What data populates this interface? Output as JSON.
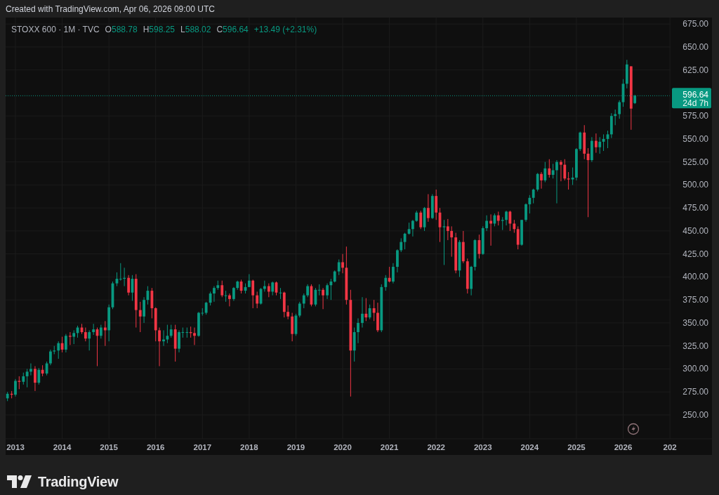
{
  "header": {
    "text": "Created with TradingView.com, Apr 06, 2026 09:00 UTC"
  },
  "chart": {
    "legend": {
      "symbol": "STOXX 600 · 1M · TVC",
      "ohlc": [
        {
          "key": "O",
          "value": "588.78"
        },
        {
          "key": "H",
          "value": "598.25"
        },
        {
          "key": "L",
          "value": "588.02"
        },
        {
          "key": "C",
          "value": "596.64"
        }
      ],
      "change": "+13.49 (+2.31%)"
    },
    "price_tag": {
      "price": "596.64",
      "countdown": "24d 7h"
    },
    "cut_axis_label": "202",
    "chart_data": {
      "type": "candlestick",
      "grid": true,
      "xlim": [
        2012.79,
        2027.9
      ],
      "ylim": [
        224,
        682
      ],
      "xticks": [
        2013,
        2014,
        2015,
        2016,
        2017,
        2018,
        2019,
        2020,
        2021,
        2022,
        2023,
        2024,
        2025,
        2026
      ],
      "yticks": [
        {
          "value": 250,
          "label": "250.00"
        },
        {
          "value": 275,
          "label": "275.00"
        },
        {
          "value": 300,
          "label": "300.00"
        },
        {
          "value": 325,
          "label": "325.00"
        },
        {
          "value": 350,
          "label": "350.00"
        },
        {
          "value": 375,
          "label": "375.00"
        },
        {
          "value": 400,
          "label": "400.00"
        },
        {
          "value": 425,
          "label": "425.00"
        },
        {
          "value": 450,
          "label": "450.00"
        },
        {
          "value": 475,
          "label": "475.00"
        },
        {
          "value": 500,
          "label": "500.00"
        },
        {
          "value": 525,
          "label": "525.00"
        },
        {
          "value": 550,
          "label": "550.00"
        },
        {
          "value": 575,
          "label": "575.00"
        },
        {
          "value": 625,
          "label": "625.00"
        },
        {
          "value": 650,
          "label": "650.00"
        },
        {
          "value": 675,
          "label": "675.00"
        }
      ],
      "ref_lines": [
        {
          "axis": "y",
          "value": 597,
          "color": "#089981"
        }
      ],
      "x": [
        2012.83,
        2012.92,
        2013,
        2013.08,
        2013.17,
        2013.25,
        2013.33,
        2013.42,
        2013.5,
        2013.58,
        2013.67,
        2013.75,
        2013.83,
        2013.92,
        2014,
        2014.08,
        2014.17,
        2014.25,
        2014.33,
        2014.42,
        2014.5,
        2014.58,
        2014.67,
        2014.75,
        2014.83,
        2014.92,
        2015,
        2015.08,
        2015.17,
        2015.25,
        2015.33,
        2015.42,
        2015.5,
        2015.58,
        2015.67,
        2015.75,
        2015.83,
        2015.92,
        2016,
        2016.08,
        2016.17,
        2016.25,
        2016.33,
        2016.42,
        2016.5,
        2016.58,
        2016.67,
        2016.75,
        2016.83,
        2016.92,
        2017,
        2017.08,
        2017.17,
        2017.25,
        2017.33,
        2017.42,
        2017.5,
        2017.58,
        2017.67,
        2017.75,
        2017.83,
        2017.92,
        2018,
        2018.08,
        2018.17,
        2018.25,
        2018.33,
        2018.42,
        2018.5,
        2018.58,
        2018.67,
        2018.75,
        2018.83,
        2018.92,
        2019,
        2019.08,
        2019.17,
        2019.25,
        2019.33,
        2019.42,
        2019.5,
        2019.58,
        2019.67,
        2019.75,
        2019.83,
        2019.92,
        2020,
        2020.08,
        2020.17,
        2020.25,
        2020.33,
        2020.42,
        2020.5,
        2020.58,
        2020.67,
        2020.75,
        2020.83,
        2020.92,
        2021,
        2021.08,
        2021.17,
        2021.25,
        2021.33,
        2021.42,
        2021.5,
        2021.58,
        2021.67,
        2021.75,
        2021.83,
        2021.92,
        2022,
        2022.08,
        2022.17,
        2022.25,
        2022.33,
        2022.42,
        2022.5,
        2022.58,
        2022.67,
        2022.75,
        2022.83,
        2022.92,
        2023,
        2023.08,
        2023.17,
        2023.25,
        2023.33,
        2023.42,
        2023.5,
        2023.58,
        2023.67,
        2023.75,
        2023.83,
        2023.92,
        2024,
        2024.08,
        2024.17,
        2024.25,
        2024.33,
        2024.42,
        2024.5,
        2024.58,
        2024.67,
        2024.75,
        2024.83,
        2024.92,
        2025,
        2025.08,
        2025.17,
        2025.25,
        2025.33,
        2025.42,
        2025.5,
        2025.58,
        2025.67,
        2025.75,
        2025.83,
        2025.92,
        2026,
        2026.08,
        2026.17,
        2026.25
      ],
      "ohlc": [
        [
          268,
          275,
          265,
          273
        ],
        [
          273,
          276,
          268,
          272
        ],
        [
          272,
          289,
          270,
          287
        ],
        [
          287,
          292,
          278,
          286
        ],
        [
          286,
          296,
          283,
          292
        ],
        [
          292,
          300,
          280,
          297
        ],
        [
          297,
          306,
          293,
          300
        ],
        [
          300,
          303,
          276,
          285
        ],
        [
          285,
          301,
          283,
          299
        ],
        [
          299,
          304,
          292,
          295
        ],
        [
          295,
          308,
          293,
          306
        ],
        [
          306,
          321,
          304,
          319
        ],
        [
          319,
          325,
          316,
          320
        ],
        [
          320,
          330,
          311,
          328
        ],
        [
          328,
          335,
          318,
          321
        ],
        [
          321,
          338,
          318,
          336
        ],
        [
          336,
          340,
          326,
          335
        ],
        [
          335,
          342,
          327,
          339
        ],
        [
          339,
          347,
          334,
          345
        ],
        [
          345,
          349,
          338,
          340
        ],
        [
          340,
          345,
          330,
          333
        ],
        [
          333,
          342,
          320,
          340
        ],
        [
          340,
          349,
          337,
          343
        ],
        [
          343,
          345,
          303,
          336
        ],
        [
          336,
          348,
          333,
          345
        ],
        [
          345,
          352,
          325,
          342
        ],
        [
          342,
          370,
          330,
          367
        ],
        [
          367,
          395,
          365,
          393
        ],
        [
          393,
          405,
          390,
          398
        ],
        [
          398,
          415,
          396,
          398
        ],
        [
          398,
          410,
          390,
          399
        ],
        [
          399,
          402,
          380,
          383
        ],
        [
          383,
          402,
          374,
          398
        ],
        [
          398,
          403,
          345,
          364
        ],
        [
          364,
          373,
          340,
          357
        ],
        [
          357,
          378,
          350,
          375
        ],
        [
          375,
          390,
          370,
          385
        ],
        [
          385,
          388,
          355,
          366
        ],
        [
          366,
          367,
          330,
          342
        ],
        [
          342,
          345,
          303,
          330
        ],
        [
          330,
          342,
          325,
          332
        ],
        [
          332,
          348,
          328,
          336
        ],
        [
          336,
          348,
          334,
          343
        ],
        [
          343,
          348,
          308,
          322
        ],
        [
          322,
          342,
          318,
          340
        ],
        [
          340,
          345,
          334,
          340
        ],
        [
          340,
          345,
          334,
          340
        ],
        [
          340,
          346,
          334,
          339
        ],
        [
          339,
          345,
          326,
          336
        ],
        [
          336,
          362,
          335,
          361
        ],
        [
          361,
          366,
          358,
          361
        ],
        [
          361,
          373,
          359,
          372
        ],
        [
          372,
          384,
          369,
          382
        ],
        [
          382,
          390,
          373,
          388
        ],
        [
          388,
          396,
          386,
          391
        ],
        [
          391,
          396,
          378,
          380
        ],
        [
          380,
          385,
          373,
          380
        ],
        [
          380,
          382,
          368,
          376
        ],
        [
          376,
          389,
          374,
          388
        ],
        [
          388,
          396,
          386,
          395
        ],
        [
          395,
          397,
          382,
          385
        ],
        [
          385,
          393,
          382,
          389
        ],
        [
          389,
          403,
          389,
          396
        ],
        [
          396,
          397,
          366,
          380
        ],
        [
          380,
          384,
          366,
          371
        ],
        [
          371,
          388,
          370,
          387
        ],
        [
          387,
          396,
          384,
          390
        ],
        [
          390,
          393,
          378,
          384
        ],
        [
          384,
          395,
          380,
          394
        ],
        [
          394,
          395,
          380,
          383
        ],
        [
          383,
          388,
          376,
          383
        ],
        [
          383,
          384,
          356,
          362
        ],
        [
          362,
          369,
          354,
          357
        ],
        [
          357,
          361,
          330,
          338
        ],
        [
          338,
          360,
          336,
          358
        ],
        [
          358,
          373,
          356,
          371
        ],
        [
          371,
          382,
          366,
          380
        ],
        [
          380,
          392,
          378,
          390
        ],
        [
          390,
          392,
          368,
          370
        ],
        [
          370,
          388,
          368,
          386
        ],
        [
          386,
          392,
          380,
          386
        ],
        [
          386,
          388,
          365,
          380
        ],
        [
          380,
          393,
          376,
          391
        ],
        [
          391,
          398,
          375,
          395
        ],
        [
          395,
          407,
          394,
          406
        ],
        [
          406,
          419,
          402,
          416
        ],
        [
          416,
          425,
          404,
          410
        ],
        [
          410,
          433,
          370,
          375
        ],
        [
          375,
          386,
          270,
          320
        ],
        [
          320,
          345,
          308,
          340
        ],
        [
          340,
          355,
          328,
          350
        ],
        [
          350,
          378,
          345,
          360
        ],
        [
          360,
          377,
          352,
          356
        ],
        [
          356,
          370,
          354,
          366
        ],
        [
          366,
          375,
          352,
          361
        ],
        [
          361,
          372,
          340,
          342
        ],
        [
          342,
          392,
          340,
          389
        ],
        [
          389,
          402,
          385,
          399
        ],
        [
          399,
          411,
          394,
          395
        ],
        [
          395,
          415,
          393,
          411
        ],
        [
          411,
          430,
          405,
          429
        ],
        [
          429,
          442,
          427,
          438
        ],
        [
          438,
          448,
          430,
          447
        ],
        [
          447,
          459,
          446,
          452
        ],
        [
          452,
          462,
          444,
          461
        ],
        [
          461,
          472,
          460,
          470
        ],
        [
          470,
          472,
          452,
          454
        ],
        [
          454,
          476,
          450,
          475
        ],
        [
          475,
          490,
          460,
          464
        ],
        [
          464,
          490,
          463,
          488
        ],
        [
          488,
          495,
          462,
          470
        ],
        [
          470,
          475,
          438,
          454
        ],
        [
          454,
          462,
          413,
          455
        ],
        [
          455,
          463,
          440,
          450
        ],
        [
          450,
          455,
          422,
          443
        ],
        [
          443,
          448,
          404,
          407
        ],
        [
          407,
          440,
          400,
          438
        ],
        [
          438,
          450,
          415,
          417
        ],
        [
          417,
          420,
          382,
          387
        ],
        [
          387,
          412,
          380,
          411
        ],
        [
          411,
          441,
          407,
          440
        ],
        [
          440,
          446,
          420,
          425
        ],
        [
          425,
          455,
          424,
          453
        ],
        [
          453,
          467,
          450,
          461
        ],
        [
          461,
          468,
          434,
          458
        ],
        [
          458,
          469,
          455,
          467
        ],
        [
          467,
          471,
          456,
          461
        ],
        [
          461,
          465,
          451,
          462
        ],
        [
          462,
          472,
          456,
          471
        ],
        [
          471,
          472,
          450,
          458
        ],
        [
          458,
          462,
          448,
          452
        ],
        [
          452,
          455,
          430,
          435
        ],
        [
          435,
          462,
          434,
          462
        ],
        [
          462,
          480,
          460,
          479
        ],
        [
          479,
          489,
          469,
          486
        ],
        [
          486,
          496,
          480,
          495
        ],
        [
          495,
          513,
          493,
          512
        ],
        [
          512,
          514,
          496,
          505
        ],
        [
          505,
          525,
          503,
          518
        ],
        [
          518,
          528,
          508,
          511
        ],
        [
          511,
          523,
          507,
          516
        ],
        [
          516,
          527,
          480,
          525
        ],
        [
          525,
          527,
          504,
          522
        ],
        [
          522,
          528,
          505,
          507
        ],
        [
          507,
          514,
          495,
          506
        ],
        [
          506,
          519,
          500,
          508
        ],
        [
          508,
          540,
          505,
          539
        ],
        [
          539,
          558,
          537,
          557
        ],
        [
          557,
          565,
          528,
          534
        ],
        [
          534,
          540,
          465,
          527
        ],
        [
          527,
          552,
          525,
          548
        ],
        [
          548,
          556,
          535,
          541
        ],
        [
          541,
          552,
          534,
          547
        ],
        [
          547,
          555,
          537,
          550
        ],
        [
          550,
          559,
          540,
          555
        ],
        [
          555,
          578,
          551,
          575
        ],
        [
          575,
          582,
          565,
          577
        ],
        [
          577,
          592,
          572,
          590
        ],
        [
          590,
          615,
          585,
          610
        ],
        [
          610,
          636,
          605,
          631
        ],
        [
          629,
          629,
          560,
          583
        ],
        [
          589,
          598,
          588,
          597
        ]
      ]
    }
  },
  "footer": {
    "logo_text": "TradingView"
  }
}
